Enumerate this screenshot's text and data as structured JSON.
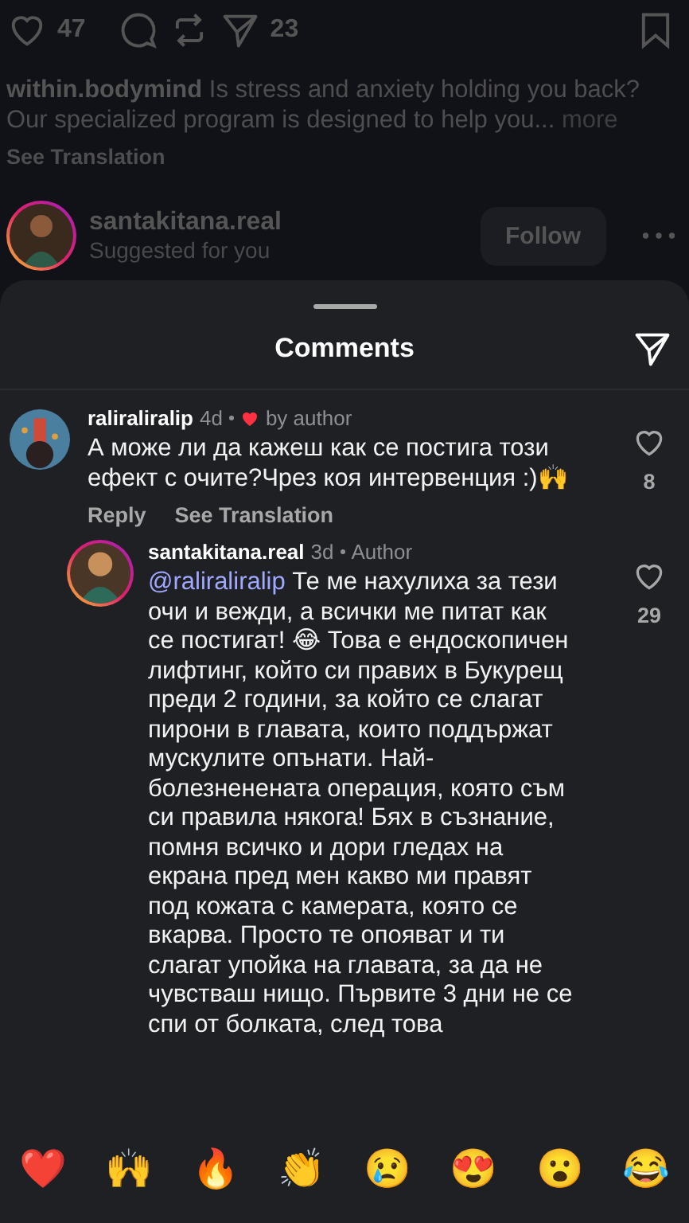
{
  "post_actions": {
    "likes": "47",
    "shares": "23"
  },
  "caption": {
    "username": "within.bodymind",
    "text": "Is stress and anxiety holding you back? Our specialized program is designed to help you...",
    "more": "more",
    "translation": "See Translation"
  },
  "suggested": {
    "username": "santakitana.real",
    "subtitle": "Suggested for you",
    "follow": "Follow",
    "has_story": true
  },
  "sheet": {
    "title": "Comments"
  },
  "comments": [
    {
      "username": "raliraliralip",
      "time": "4d",
      "liked_by_author": true,
      "author_label": "by author",
      "text": "А може ли да кажеш как се постига този ефект с очите?Чрез коя интервенция :)🙌",
      "likes": "8",
      "has_story": false,
      "reply": "Reply",
      "translation": "See Translation",
      "replies": [
        {
          "username": "santakitana.real",
          "time": "3d",
          "author_label": "Author",
          "mention": "@raliraliralip",
          "text": "Те ме нахулиха за тези очи и вежди, а всички ме питат как се постигат! 😂 Това е ендоскопичен лифтинг, който си правих в Букурещ преди 2 години, за който се слагат пирони в главата, които поддържат мускулите опънати. Най-болезненената операция, която съм си правила някога! Бях в съзнание, помня всичко и дори гледах на екрана пред мен какво ми правят под кожата с камерата, която се вкарва. Просто те опояват и ти слагат упойка на главата, за да не чувстваш нищо. Първите 3 дни не се спи от болката, след това",
          "likes": "29",
          "has_story": true
        }
      ]
    }
  ],
  "reactions": [
    "❤️",
    "🙌",
    "🔥",
    "👏",
    "😢",
    "😍",
    "😮",
    "😂"
  ]
}
